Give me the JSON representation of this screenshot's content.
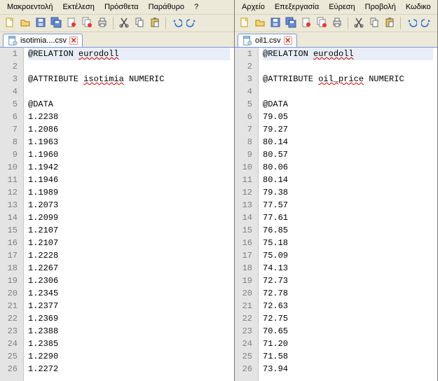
{
  "left": {
    "menu": [
      "Μακροεντολή",
      "Εκτέλεση",
      "Πρόσθετα",
      "Παράθυρο",
      "?"
    ],
    "tab": {
      "label": "isotimia....csv"
    },
    "lines": [
      "@RELATION eurodoll",
      "",
      "@ATTRIBUTE isotimia NUMERIC",
      "",
      "@DATA",
      "1.2238",
      "1.2086",
      "1.1963",
      "1.1960",
      "1.1942",
      "1.1946",
      "1.1989",
      "1.2073",
      "1.2099",
      "1.2107",
      "1.2107",
      "1.2228",
      "1.2267",
      "1.2306",
      "1.2345",
      "1.2377",
      "1.2369",
      "1.2388",
      "1.2385",
      "1.2290",
      "1.2272"
    ],
    "underlineTokens": {
      "0": "eurodoll",
      "2": "isotimia"
    }
  },
  "right": {
    "menu": [
      "Αρχείο",
      "Επεξεργασία",
      "Εύρεση",
      "Προβολή",
      "Κωδικο"
    ],
    "tab": {
      "label": "oil1.csv"
    },
    "lines": [
      "@RELATION eurodoll",
      "",
      "@ATTRIBUTE oil_price NUMERIC",
      "",
      "@DATA",
      "79.05",
      "79.27",
      "80.14",
      "80.57",
      "80.06",
      "80.14",
      "79.38",
      "77.57",
      "77.61",
      "76.85",
      "75.18",
      "75.09",
      "74.13",
      "72.73",
      "72.78",
      "72.63",
      "72.75",
      "70.65",
      "71.20",
      "71.58",
      "73.94"
    ],
    "underlineTokens": {
      "0": "eurodoll",
      "2": "oil_price"
    }
  },
  "icons": {
    "new": "new",
    "open": "open",
    "save": "save",
    "saveall": "saveall",
    "close": "close",
    "closeall": "closeall",
    "print": "print",
    "cut": "cut",
    "copy": "copy",
    "paste": "paste",
    "undo": "undo",
    "redo": "redo"
  }
}
